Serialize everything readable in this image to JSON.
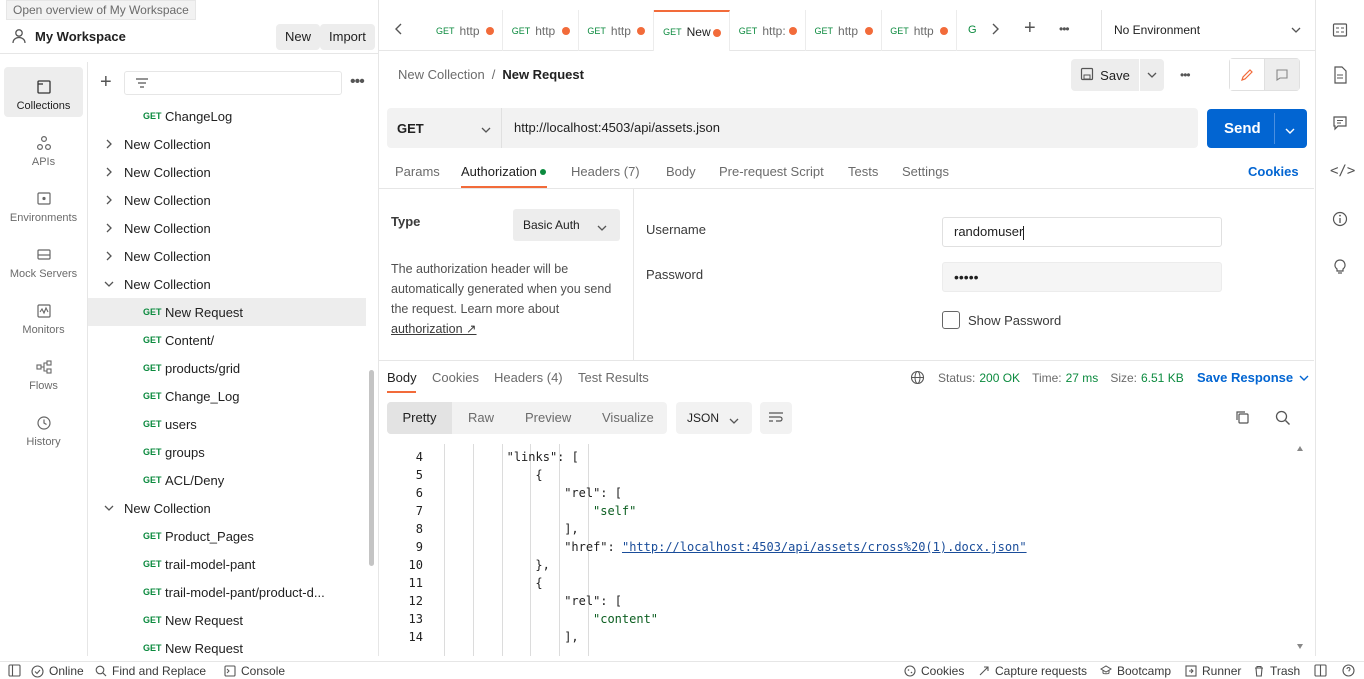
{
  "tooltip": "Open overview of My Workspace",
  "workspace": {
    "name": "My Workspace",
    "new_label": "New",
    "import_label": "Import"
  },
  "rail": [
    {
      "label": "Collections",
      "icon": "collections-icon"
    },
    {
      "label": "APIs",
      "icon": "apis-icon"
    },
    {
      "label": "Environments",
      "icon": "environments-icon"
    },
    {
      "label": "Mock Servers",
      "icon": "mock-servers-icon"
    },
    {
      "label": "Monitors",
      "icon": "monitors-icon"
    },
    {
      "label": "Flows",
      "icon": "flows-icon"
    },
    {
      "label": "History",
      "icon": "history-icon"
    }
  ],
  "tree": [
    {
      "type": "request",
      "method": "GET",
      "name": "ChangeLog",
      "depth": 1
    },
    {
      "type": "collection",
      "name": "New Collection",
      "expanded": false
    },
    {
      "type": "collection",
      "name": "New Collection",
      "expanded": false
    },
    {
      "type": "collection",
      "name": "New Collection",
      "expanded": false
    },
    {
      "type": "collection",
      "name": "New Collection",
      "expanded": false
    },
    {
      "type": "collection",
      "name": "New Collection",
      "expanded": false
    },
    {
      "type": "collection",
      "name": "New Collection",
      "expanded": true
    },
    {
      "type": "request",
      "method": "GET",
      "name": "New Request",
      "selected": true
    },
    {
      "type": "request",
      "method": "GET",
      "name": "Content/"
    },
    {
      "type": "request",
      "method": "GET",
      "name": "products/grid"
    },
    {
      "type": "request",
      "method": "GET",
      "name": "Change_Log"
    },
    {
      "type": "request",
      "method": "GET",
      "name": "users"
    },
    {
      "type": "request",
      "method": "GET",
      "name": "groups"
    },
    {
      "type": "request",
      "method": "GET",
      "name": "ACL/Deny"
    },
    {
      "type": "collection",
      "name": "New Collection",
      "expanded": true
    },
    {
      "type": "request",
      "method": "GET",
      "name": "Product_Pages"
    },
    {
      "type": "request",
      "method": "GET",
      "name": "trail-model-pant"
    },
    {
      "type": "request",
      "method": "GET",
      "name": "trail-model-pant/product-d..."
    },
    {
      "type": "request",
      "method": "GET",
      "name": "New Request"
    },
    {
      "type": "request",
      "method": "GET",
      "name": "New Request"
    }
  ],
  "tabs": [
    {
      "method": "GET",
      "name": "http"
    },
    {
      "method": "GET",
      "name": "http"
    },
    {
      "method": "GET",
      "name": "http"
    },
    {
      "method": "GET",
      "name": "New",
      "active": true
    },
    {
      "method": "GET",
      "name": "http:"
    },
    {
      "method": "GET",
      "name": "http"
    },
    {
      "method": "GET",
      "name": "http"
    }
  ],
  "environment": "No Environment",
  "breadcrumb": {
    "collection": "New Collection",
    "separator": "/",
    "request": "New Request"
  },
  "save_label": "Save",
  "request": {
    "method": "GET",
    "url": "http://localhost:4503/api/assets.json",
    "send_label": "Send"
  },
  "subtabs": [
    "Params",
    "Authorization",
    "Headers (7)",
    "Body",
    "Pre-request Script",
    "Tests",
    "Settings"
  ],
  "cookies_label": "Cookies",
  "auth": {
    "type_label": "Type",
    "type_value": "Basic Auth",
    "description": "The authorization header will be automatically generated when you send the request. Learn more about",
    "link_text": "authorization ↗",
    "username_label": "Username",
    "username_value": "randomuser",
    "password_label": "Password",
    "password_value": "•••••",
    "show_password_label": "Show Password"
  },
  "response": {
    "tabs": [
      "Body",
      "Cookies",
      "Headers (4)",
      "Test Results"
    ],
    "status_label": "Status:",
    "status_value": "200 OK",
    "time_label": "Time:",
    "time_value": "27 ms",
    "size_label": "Size:",
    "size_value": "6.51 KB",
    "save_response_label": "Save Response",
    "view_modes": [
      "Pretty",
      "Raw",
      "Preview",
      "Visualize"
    ],
    "format": "JSON"
  },
  "code_lines": [
    {
      "n": "4",
      "indent": 3,
      "text": "\"links\": ["
    },
    {
      "n": "5",
      "indent": 4,
      "text": "{"
    },
    {
      "n": "6",
      "indent": 5,
      "text": "\"rel\": ["
    },
    {
      "n": "7",
      "indent": 6,
      "text": "\"self\""
    },
    {
      "n": "8",
      "indent": 5,
      "text": "],"
    },
    {
      "n": "9",
      "indent": 5,
      "text": "\"href\": ",
      "link": "\"http://localhost:4503/api/assets/cross%20(1).docx.json\""
    },
    {
      "n": "10",
      "indent": 4,
      "text": "},"
    },
    {
      "n": "11",
      "indent": 4,
      "text": "{"
    },
    {
      "n": "12",
      "indent": 5,
      "text": "\"rel\": ["
    },
    {
      "n": "13",
      "indent": 6,
      "text": "\"content\""
    },
    {
      "n": "14",
      "indent": 5,
      "text": "],"
    }
  ],
  "statusbar": {
    "online": "Online",
    "find_replace": "Find and Replace",
    "console": "Console",
    "cookies": "Cookies",
    "capture": "Capture requests",
    "bootcamp": "Bootcamp",
    "runner": "Runner",
    "trash": "Trash"
  },
  "colors": {
    "accent": "#f26b3a",
    "send": "#0265d2",
    "get": "#0b8a3e",
    "status_ok": "#0b8a3e"
  }
}
